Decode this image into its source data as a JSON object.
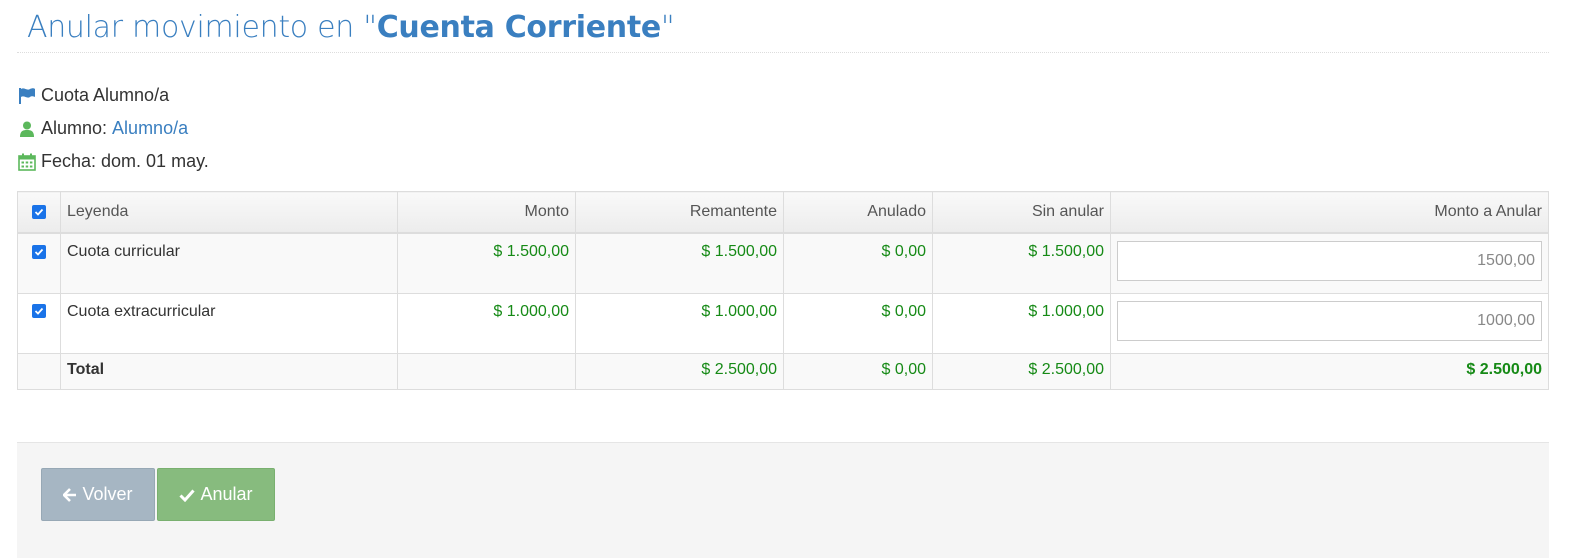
{
  "header": {
    "title_prefix": "Anular movimiento en \"",
    "title_bold": "Cuenta Corriente",
    "title_suffix": "\""
  },
  "info": {
    "concept": "Cuota Alumno/a",
    "student_label": "Alumno:",
    "student_link": "Alumno/a",
    "date": "Fecha: dom. 01 may."
  },
  "table": {
    "headers": [
      "Leyenda",
      "Monto",
      "Remantente",
      "Anulado",
      "Sin anular",
      "Monto a Anular"
    ],
    "rows": [
      {
        "leyenda": "Cuota curricular",
        "monto": "$ 1.500,00",
        "remanente": "$ 1.500,00",
        "anulado": "$ 0,00",
        "sin_anular": "$ 1.500,00",
        "monto_anular": "1500,00",
        "checked": true
      },
      {
        "leyenda": "Cuota extracurricular",
        "monto": "$ 1.000,00",
        "remanente": "$ 1.000,00",
        "anulado": "$ 0,00",
        "sin_anular": "$ 1.000,00",
        "monto_anular": "1000,00",
        "checked": true
      }
    ],
    "total": {
      "label": "Total",
      "remanente": "$ 2.500,00",
      "anulado": "$ 0,00",
      "sin_anular": "$ 2.500,00",
      "monto_anular": "$ 2.500,00"
    }
  },
  "actions": {
    "back_label": "Volver",
    "confirm_label": "Anular"
  },
  "colors": {
    "accent": "#3a7fc0",
    "money": "#168a16",
    "back_button": "#a6b6c3",
    "confirm_button": "#87bb7e"
  }
}
